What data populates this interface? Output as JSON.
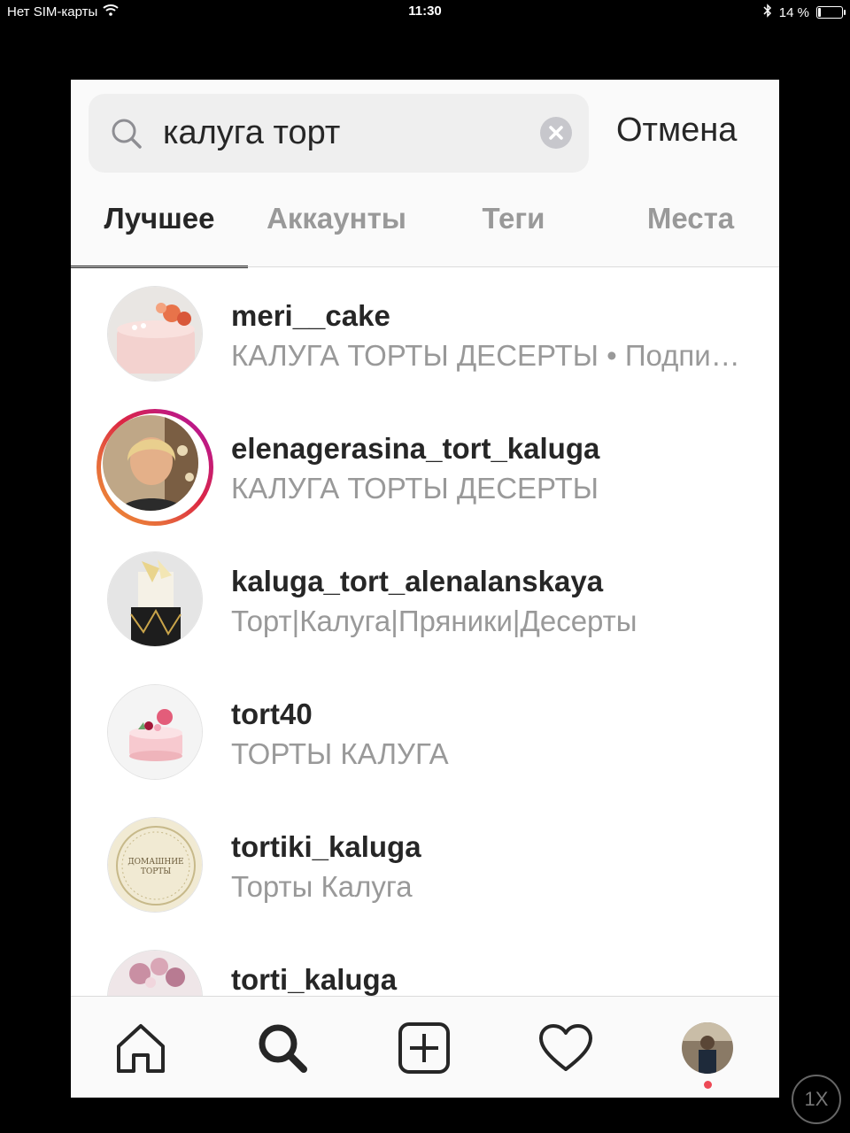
{
  "status_bar": {
    "carrier": "Нет SIM-карты",
    "time": "11:30",
    "battery_text": "14 %",
    "battery_level": 0.14
  },
  "search": {
    "query": "калуга торт",
    "cancel_label": "Отмена"
  },
  "tabs": [
    {
      "label": "Лучшее",
      "active": true
    },
    {
      "label": "Аккаунты",
      "active": false
    },
    {
      "label": "Теги",
      "active": false
    },
    {
      "label": "Места",
      "active": false
    }
  ],
  "results": [
    {
      "username": "meri__cake",
      "subtitle": "КАЛУГА ТОРТЫ ДЕСЕРТЫ • Подписан(-а)",
      "story_ring": false
    },
    {
      "username": "elenagerasina_tort_kaluga",
      "subtitle": "КАЛУГА ТОРТЫ ДЕСЕРТЫ",
      "story_ring": true
    },
    {
      "username": "kaluga_tort_alenalanskaya",
      "subtitle": "Торт|Калуга|Пряники|Десерты",
      "story_ring": false
    },
    {
      "username": "tort40",
      "subtitle": "ТОРТЫ КАЛУГА",
      "story_ring": false
    },
    {
      "username": "tortiki_kaluga",
      "subtitle": "Торты Калуга",
      "story_ring": false
    },
    {
      "username": "torti_kaluga",
      "subtitle": "",
      "story_ring": false
    }
  ],
  "avatar_logo_text": "ДОМАШНИЕ ТОРТЫ",
  "zoom_badge": "1X",
  "colors": {
    "story_ring": "#dc2743",
    "notification_dot": "#ed4956",
    "text_primary": "#262626",
    "text_secondary": "#999999"
  },
  "icons": [
    "wifi-icon",
    "bluetooth-icon",
    "search-icon",
    "clear-icon",
    "home-icon",
    "search-nav-icon",
    "add-post-icon",
    "heart-icon",
    "profile-avatar"
  ]
}
